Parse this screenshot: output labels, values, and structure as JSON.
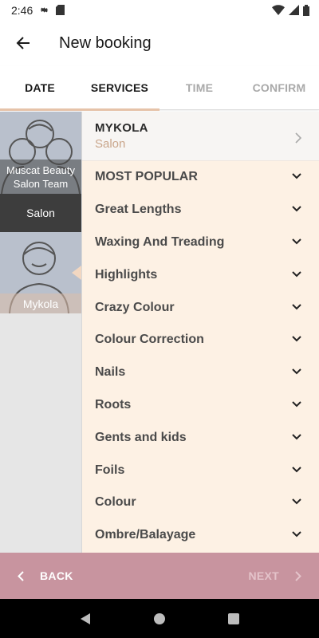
{
  "status_bar": {
    "time": "2:46"
  },
  "app_bar": {
    "title": "New booking"
  },
  "tabs": [
    {
      "label": "DATE",
      "state": "enabled"
    },
    {
      "label": "SERVICES",
      "state": "active"
    },
    {
      "label": "TIME",
      "state": "disabled"
    },
    {
      "label": "CONFIRM",
      "state": "disabled"
    }
  ],
  "staff": {
    "team": {
      "name": "Muscat Beauty Salon Team",
      "role": "Salon"
    },
    "member": {
      "name": "Mykola"
    }
  },
  "services": {
    "header": {
      "name": "MYKOLA",
      "subtitle": "Salon"
    },
    "categories": [
      "MOST POPULAR",
      "Great Lengths",
      "Waxing And Treading",
      "Highlights",
      "Crazy Colour",
      "Colour Correction",
      "Nails",
      "Roots",
      "Gents and kids",
      "Foils",
      "Colour",
      "Ombre/Balayage"
    ]
  },
  "bottom_bar": {
    "back_label": "BACK",
    "next_label": "NEXT"
  },
  "colors": {
    "accent_peach": "#e6c3a9",
    "list_background": "#fdf1e4",
    "bottom_bar": "#c8949f",
    "salon_subtitle": "#c9a58a"
  },
  "icons": {
    "status": [
      "gear-icon",
      "sd-card-icon",
      "wifi-icon",
      "signal-icon",
      "battery-icon"
    ],
    "nav": [
      "nav-back-icon",
      "nav-home-icon",
      "nav-recents-icon"
    ]
  }
}
